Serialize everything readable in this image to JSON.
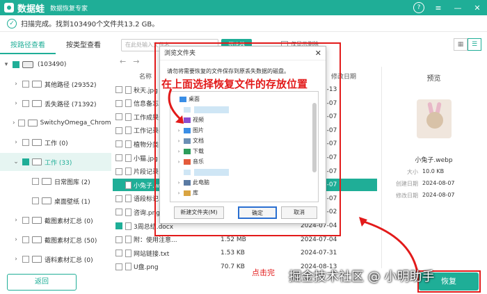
{
  "app": {
    "name": "数据蛙",
    "subtitle": "数据恢复专家"
  },
  "window_controls": [
    "?",
    "≡",
    "—",
    "✕"
  ],
  "status": {
    "text": "扫描完成。找到103490个文件共13.2 GB。"
  },
  "tabs": [
    {
      "label": "按路径查看",
      "active": true
    },
    {
      "label": "按类型查看",
      "active": false
    }
  ],
  "tree": [
    {
      "label": "(103490)",
      "level": 0,
      "caret": "▾",
      "checked": true,
      "drive": true
    },
    {
      "label": "其他路径 (29352)",
      "level": 1,
      "caret": "›",
      "checked": false
    },
    {
      "label": "丢失路径 (71392)",
      "level": 1,
      "caret": "›",
      "checked": false
    },
    {
      "label": "SwitchyOmega_Chromium",
      "level": 1,
      "caret": "›",
      "checked": false
    },
    {
      "label": "工作 (0)",
      "level": 1,
      "caret": "›",
      "checked": false
    },
    {
      "label": "工作 (33)",
      "level": 1,
      "caret": "⌄",
      "checked": true,
      "selected": true
    },
    {
      "label": "日常图库 (2)",
      "level": 2,
      "caret": "",
      "checked": false
    },
    {
      "label": "桌面壁纸 (1)",
      "level": 2,
      "caret": "",
      "checked": false
    },
    {
      "label": "截图素材汇总 (0)",
      "level": 1,
      "caret": "›",
      "checked": false
    },
    {
      "label": "截图素材汇总 (50)",
      "level": 1,
      "caret": "›",
      "checked": false
    },
    {
      "label": "语料素材汇总 (0)",
      "level": 1,
      "caret": "›",
      "checked": false
    }
  ],
  "back_label": "返回",
  "search": {
    "placeholder": "在此处输入文件名",
    "button": "筛选器",
    "filter_label": "仅显示删除"
  },
  "columns": {
    "name": "名称",
    "date": "修改日期"
  },
  "files": [
    {
      "name": "秋天.jpg",
      "size": "",
      "date": "2024-08-13",
      "checked": false
    },
    {
      "name": "信息备忘.txt",
      "size": "",
      "date": "2024-08-07",
      "checked": false
    },
    {
      "name": "工作成果分享...",
      "size": "",
      "date": "2024-08-07",
      "checked": false
    },
    {
      "name": "工作记录表.docx",
      "size": "",
      "date": "2024-08-07",
      "checked": false
    },
    {
      "name": "植物分类.docx",
      "size": "",
      "date": "2024-08-07",
      "checked": false
    },
    {
      "name": "小猫.jpg",
      "size": "",
      "date": "2024-08-07",
      "checked": false
    },
    {
      "name": "片段记录.docx",
      "size": "",
      "date": "2024-08-07",
      "checked": false
    },
    {
      "name": "小兔子.webp",
      "size": "",
      "date": "2024-08-07",
      "checked": true,
      "selected": true
    },
    {
      "name": "语段标记.docx",
      "size": "",
      "date": "2024-08-07",
      "checked": false
    },
    {
      "name": "咨询.png",
      "size": "",
      "date": "2024-07-02",
      "checked": false
    },
    {
      "name": "3周总结.docx",
      "size": "",
      "date": "2024-07-04",
      "checked": true
    },
    {
      "name": "附：使用注意...",
      "size": "1.52 MB",
      "date": "2024-07-04",
      "checked": false
    },
    {
      "name": "网站链接.txt",
      "size": "1.53 KB",
      "date": "2024-07-31",
      "checked": false
    },
    {
      "name": "U盘.png",
      "size": "70.7 KB",
      "date": "2024-08-13",
      "checked": false
    }
  ],
  "preview": {
    "title": "预览",
    "filename": "小兔子.webp",
    "meta": [
      {
        "key": "大小",
        "value": "10.0 KB"
      },
      {
        "key": "创建日期",
        "value": "2024-08-07"
      },
      {
        "key": "修改日期",
        "value": "2024-08-07"
      }
    ]
  },
  "recover_label": "恢复",
  "dialog": {
    "title": "浏览文件夹",
    "close": "✕",
    "message": "请勿将需要恢复的文件保存到原丢失数据的磁盘。",
    "tree": [
      {
        "label": "桌面",
        "level": 0,
        "caret": "",
        "color": "#3a8ee6"
      },
      {
        "label": "",
        "level": 1,
        "caret": "",
        "color": "#cfe6f5"
      },
      {
        "label": "视频",
        "level": 1,
        "caret": "›",
        "color": "#8a4fd0"
      },
      {
        "label": "图片",
        "level": 1,
        "caret": "›",
        "color": "#3a8ee6"
      },
      {
        "label": "文档",
        "level": 1,
        "caret": "›",
        "color": "#6b8fb5"
      },
      {
        "label": "下载",
        "level": 1,
        "caret": "›",
        "color": "#2d9d5b"
      },
      {
        "label": "音乐",
        "level": 1,
        "caret": "›",
        "color": "#e45b3b"
      },
      {
        "label": "",
        "level": 1,
        "caret": "",
        "color": "#cfe6f5"
      },
      {
        "label": "此电脑",
        "level": 1,
        "caret": "›",
        "color": "#5a7aa3"
      },
      {
        "label": "库",
        "level": 1,
        "caret": "›",
        "color": "#d9a441"
      }
    ],
    "new_folder": "新建文件夹(M)",
    "ok": "确定",
    "cancel": "取消"
  },
  "annotations": {
    "main": "在上面选择恢复文件的存放位置",
    "click": "点击完",
    "watermark": "掘金技术社区 @ 小明助手"
  },
  "colors": {
    "accent": "#1fae97",
    "annotation": "#e21a1a"
  }
}
